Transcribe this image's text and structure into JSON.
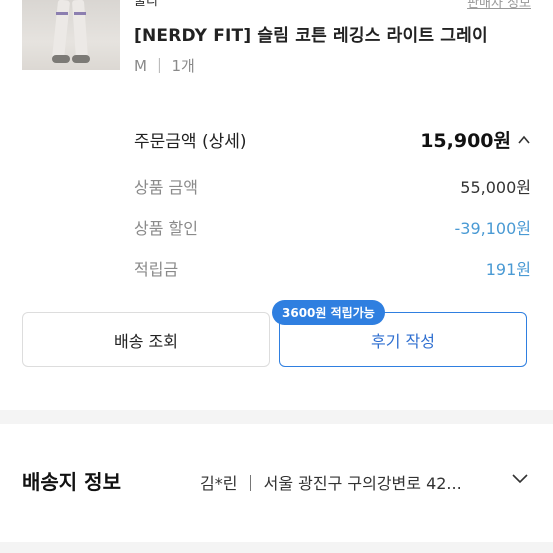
{
  "product": {
    "seller_name": "쿨리",
    "seller_info_link": "판매자 정보",
    "name": "[NERDY FIT] 슬림 코튼 레깅스 라이트 그레이",
    "option": "M ｜ 1개"
  },
  "payment": {
    "total_label": "주문금액 (상세)",
    "total_value": "15,900원",
    "product_amount_label": "상품 금액",
    "product_amount_value": "55,000원",
    "discount_label": "상품 할인",
    "discount_value": "-39,100원",
    "points_label": "적립금",
    "points_value": "191원"
  },
  "actions": {
    "ship_track_label": "배송 조회",
    "review_label": "후기 작성",
    "review_badge": "3600원 적립가능"
  },
  "shipping": {
    "title": "배송지 정보",
    "summary": "김*린 ｜ 서울 광진구 구의강변로 42..."
  },
  "colors": {
    "accent_blue": "#2f7fe0",
    "discount_blue": "#4a9ad4"
  },
  "icons": {
    "total_toggle": "chevron-up-icon",
    "shipping_toggle": "chevron-down-icon"
  }
}
